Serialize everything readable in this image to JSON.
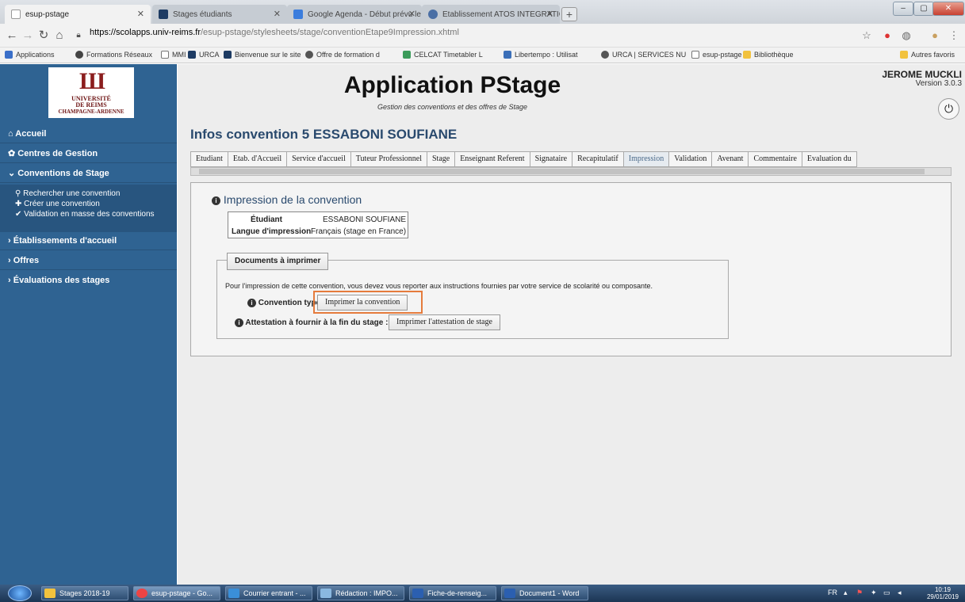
{
  "browser": {
    "tabs": [
      {
        "title": "esup-pstage",
        "active": true
      },
      {
        "title": "Stages étudiants"
      },
      {
        "title": "Google Agenda - Début prévu le"
      },
      {
        "title": "Etablissement ATOS INTEGRATIC"
      }
    ],
    "url_domain": "https://scolapps.univ-reims.fr",
    "url_path": "/esup-pstage/stylesheets/stage/conventionEtape9Impression.xhtml",
    "bookmarks": [
      "Applications",
      "Formations Réseaux",
      "MMI",
      "URCA",
      "Bienvenue sur le site",
      "Offre de formation d",
      "CELCAT Timetabler L",
      "Libertempo : Utilisat",
      "URCA | SERVICES NU",
      "esup-pstage",
      "Bibliothèque"
    ],
    "other_bookmarks": "Autres favoris"
  },
  "logo": {
    "line1": "UNIVERSITÉ",
    "line2": "DE REIMS",
    "line3": "CHAMPAGNE-ARDENNE"
  },
  "sidebar": {
    "items": [
      {
        "label": "Accueil",
        "icon": "home"
      },
      {
        "label": "Centres de Gestion",
        "icon": "gear"
      },
      {
        "label": "Conventions de Stage",
        "icon": "chevron-down"
      }
    ],
    "sub_items": [
      "Rechercher une convention",
      "Créer une convention",
      "Validation en masse des conventions"
    ],
    "items2": [
      {
        "label": "Établissements d'accueil"
      },
      {
        "label": "Offres"
      },
      {
        "label": "Évaluations des stages"
      }
    ]
  },
  "header": {
    "title": "Application PStage",
    "subtitle": "Gestion des conventions et des offres de Stage",
    "user": "JEROME MUCKLI",
    "version": "Version 3.0.3"
  },
  "page": {
    "title": "Infos convention 5 ESSABONI SOUFIANE",
    "tabs": [
      "Etudiant",
      "Etab. d'Accueil",
      "Service d'accueil",
      "Tuteur Professionnel",
      "Stage",
      "Enseignant Referent",
      "Signataire",
      "Recapitulatif",
      "Impression",
      "Validation",
      "Avenant",
      "Commentaire",
      "Evaluation du"
    ],
    "selected_tab": "Impression"
  },
  "impression": {
    "section_title": "Impression de la convention",
    "student_label": "Étudiant",
    "student_value": "ESSABONI SOUFIANE",
    "lang_label": "Langue d'impression",
    "lang_value": "Français (stage en France)",
    "docs_button": "Documents à imprimer",
    "instructions": "Pour l'impression de cette convention, vous devez vous reporter aux instructions fournies par votre service de scolarité ou composante.",
    "convention_label": "Convention type",
    "convention_button": "Imprimer la convention",
    "attestation_label": "Attestation à fournir à la fin du stage :",
    "attestation_button": "Imprimer l'attestation de stage"
  },
  "taskbar": {
    "items": [
      "Stages 2018-19",
      "esup-pstage - Go...",
      "Courrier entrant - ...",
      "Rédaction : IMPO...",
      "Fiche-de-renseig...",
      "Document1 - Word"
    ],
    "lang": "FR",
    "time": "10:19",
    "date": "29/01/2019"
  }
}
